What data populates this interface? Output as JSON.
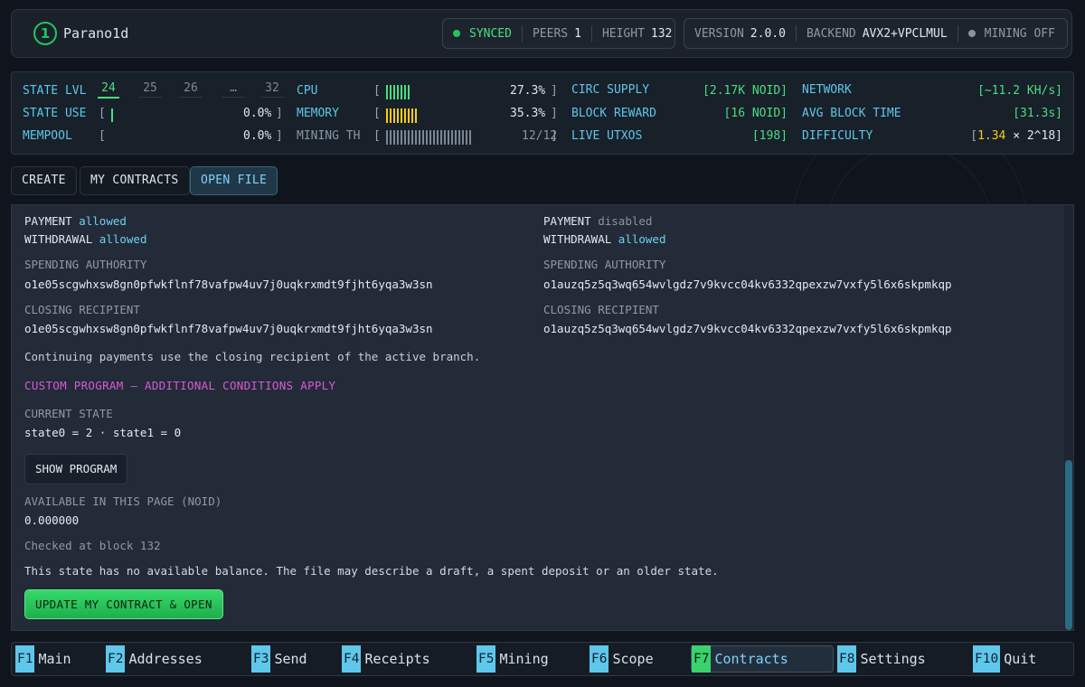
{
  "header": {
    "logo_glyph": "1",
    "app_name": "Parano1d",
    "status": {
      "synced": "SYNCED",
      "peers_label": "PEERS",
      "peers": "1",
      "height_label": "HEIGHT",
      "height": "132"
    },
    "info": {
      "version_label": "VERSION",
      "version": "2.0.0",
      "backend_label": "BACKEND",
      "backend": "AVX2+VPCLMUL",
      "mining": "MINING OFF"
    }
  },
  "stats": {
    "state_lvl_label": "STATE LVL",
    "levels": [
      "24",
      "25",
      "26",
      "…",
      "32"
    ],
    "active_level": "24",
    "state_use_label": "STATE USE",
    "state_use_open": "[",
    "state_use_value": "0.0%",
    "mempool_label": "MEMPOOL",
    "mempool_open": "[",
    "mempool_value": "0.0%",
    "close_bracket": "]",
    "cpu_label": "CPU",
    "cpu_value": "27.3%",
    "cpu_fraction": 0.273,
    "memory_label": "MEMORY",
    "memory_value": "35.3%",
    "memory_fraction": 0.353,
    "mining_th_label": "MINING TH",
    "mining_th_value": "12/12",
    "circ_supply_label": "CIRC SUPPLY",
    "circ_supply_value": "[2.17K NOID]",
    "block_reward_label": "BLOCK REWARD",
    "block_reward_value": "[16 NOID]",
    "live_utxos_label": "LIVE UTXOS",
    "live_utxos_value": "[198]",
    "network_label": "NETWORK",
    "network_value": "[~11.2 KH/s]",
    "avg_block_time_label": "AVG BLOCK TIME",
    "avg_block_time_value": "[31.3s]",
    "difficulty_label": "DIFFICULTY",
    "difficulty_open": "[",
    "difficulty_value": "1.34",
    "difficulty_rest": " × 2^18]"
  },
  "tabs": {
    "create": "CREATE",
    "my_contracts": "MY CONTRACTS",
    "open_file": "OPEN FILE",
    "active": "OPEN FILE"
  },
  "content": {
    "left": {
      "payment_label": "PAYMENT",
      "payment_value": "allowed",
      "withdrawal_label": "WITHDRAWAL",
      "withdrawal_value": "allowed",
      "spending_authority_label": "SPENDING AUTHORITY",
      "spending_authority": "o1e05scgwhxsw8gn0pfwkflnf78vafpw4uv7j0uqkrxmdt9fjht6yqa3w3sn",
      "closing_recipient_label": "CLOSING RECIPIENT",
      "closing_recipient": "o1e05scgwhxsw8gn0pfwkflnf78vafpw4uv7j0uqkrxmdt9fjht6yqa3w3sn"
    },
    "right": {
      "payment_label": "PAYMENT",
      "payment_value": "disabled",
      "withdrawal_label": "WITHDRAWAL",
      "withdrawal_value": "allowed",
      "spending_authority_label": "SPENDING AUTHORITY",
      "spending_authority": "o1auzq5z5q3wq654wvlgdz7v9kvcc04kv6332qpexzw7vxfy5l6x6skpmkqp",
      "closing_recipient_label": "CLOSING RECIPIENT",
      "closing_recipient": "o1auzq5z5q3wq654wvlgdz7v9kvcc04kv6332qpexzw7vxfy5l6x6skpmkqp"
    },
    "continuing_note": "Continuing payments use the closing recipient of the active branch.",
    "custom_program_warning": "CUSTOM PROGRAM — ADDITIONAL CONDITIONS APPLY",
    "current_state_label": "CURRENT STATE",
    "current_state": "state0 = 2 · state1 = 0",
    "show_program_button": "SHOW PROGRAM",
    "available_label": "AVAILABLE IN THIS PAGE (NOID)",
    "available_value": "0.000000",
    "checked_at": "Checked at block 132",
    "no_balance_note": "This state has no available balance. The file may describe a draft, a spent deposit or an older state.",
    "update_button": "UPDATE MY CONTRACT & OPEN"
  },
  "bottom_nav": [
    {
      "key": "F1",
      "label": "Main"
    },
    {
      "key": "F2",
      "label": "Addresses"
    },
    {
      "key": "F3",
      "label": "Send"
    },
    {
      "key": "F4",
      "label": "Receipts"
    },
    {
      "key": "F5",
      "label": "Mining"
    },
    {
      "key": "F6",
      "label": "Scope"
    },
    {
      "key": "F7",
      "label": "Contracts"
    },
    {
      "key": "F8",
      "label": "Settings"
    },
    {
      "key": "F10",
      "label": "Quit"
    }
  ],
  "active_nav": "Contracts",
  "colors": {
    "accent_green": "#22c55e",
    "accent_cyan": "#5fc6ea",
    "warning_yellow": "#facc15",
    "magenta": "#d65bd6",
    "panel_bg": "#232a38"
  }
}
